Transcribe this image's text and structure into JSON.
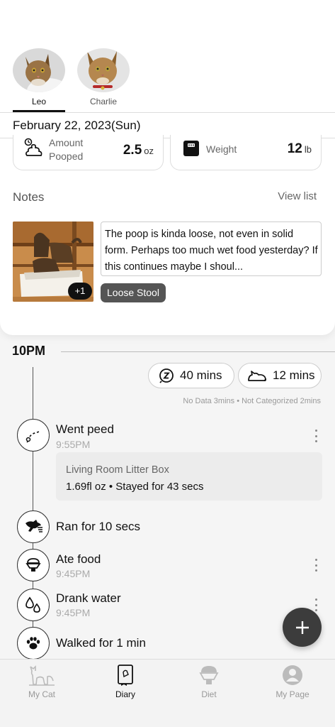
{
  "cats": [
    {
      "name": "Leo",
      "selected": true
    },
    {
      "name": "Charlie",
      "selected": false
    }
  ],
  "date": "February 22, 2023(Sun)",
  "stats": {
    "poop": {
      "label_line1": "Amount",
      "label_line2": "Pooped",
      "value": "2.5",
      "unit": "oz"
    },
    "weight": {
      "label": "Weight",
      "value": "12",
      "unit": "lb"
    }
  },
  "notes": {
    "title": "Notes",
    "view_list": "View list",
    "photo_badge": "+1",
    "text": "The poop is kinda loose, not even in solid form. Perhaps too much wet food yesterday? If this continues maybe I shoul...",
    "tag": "Loose Stool"
  },
  "timeline": {
    "hour": "10PM",
    "sleep_pill": "40 mins",
    "out_pill": "12 mins",
    "legend": "No Data  3mins  •  Not Categorized  2mins",
    "events": [
      {
        "title": "Went peed",
        "time": "9:55PM",
        "icon": "pee-trail-icon"
      },
      {
        "title": "Ran for 10 secs",
        "time": "",
        "icon": "running-cat-icon"
      },
      {
        "title": "Ate food",
        "time": "9:45PM",
        "icon": "food-bowl-icon"
      },
      {
        "title": "Drank water",
        "time": "9:45PM",
        "icon": "water-drops-icon"
      },
      {
        "title": "Walked for 1 min",
        "time": "",
        "icon": "paw-icon"
      }
    ],
    "detail": {
      "location": "Living Room Litter Box",
      "info": "1.69fl oz • Stayed for 43 secs"
    }
  },
  "nav": {
    "items": [
      {
        "label": "My Cat",
        "icon": "cat-icon",
        "active": false
      },
      {
        "label": "Diary",
        "icon": "diary-icon",
        "active": true
      },
      {
        "label": "Diet",
        "icon": "diet-bowl-icon",
        "active": false
      },
      {
        "label": "My Page",
        "icon": "profile-icon",
        "active": false
      }
    ]
  },
  "colors": {
    "accent": "#111111",
    "fab": "#3c3c3c",
    "tag": "#555555"
  }
}
